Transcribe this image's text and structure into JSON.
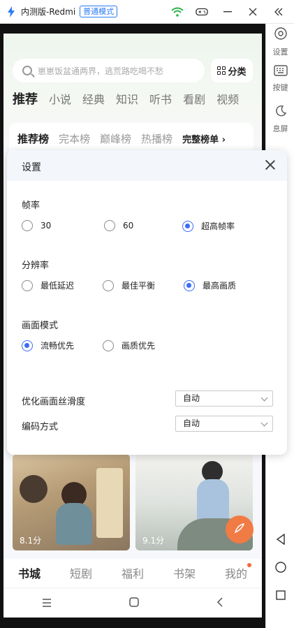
{
  "titlebar": {
    "title": "内测版-Redmi",
    "mode_badge": "普通模式"
  },
  "sidebar": {
    "items": [
      {
        "label": "设置",
        "icon": "settings-icon"
      },
      {
        "label": "按键",
        "icon": "keyboard-icon"
      },
      {
        "label": "息屏",
        "icon": "moon-icon"
      }
    ]
  },
  "app": {
    "search_placeholder": "崽崽饭盆通两界，逃荒路吃喝不愁",
    "category_button": "分类",
    "tabs": [
      "推荐",
      "小说",
      "经典",
      "知识",
      "听书",
      "看剧",
      "视频"
    ],
    "ranks": [
      "推荐榜",
      "完本榜",
      "巅峰榜",
      "热播榜"
    ],
    "rank_more": "完整榜单 ›",
    "covers": [
      {
        "rating": "8.1分"
      },
      {
        "rating": "9.1分"
      }
    ],
    "bottom_nav": [
      "书城",
      "短剧",
      "福利",
      "书架",
      "我的"
    ]
  },
  "settings": {
    "title": "设置",
    "frame_rate": {
      "label": "帧率",
      "options": [
        "30",
        "60",
        "超高帧率"
      ],
      "selected": "超高帧率"
    },
    "resolution": {
      "label": "分辨率",
      "options": [
        "最低延迟",
        "最佳平衡",
        "最高画质"
      ],
      "selected": "最高画质"
    },
    "picture_mode": {
      "label": "画面模式",
      "options": [
        "流畅优先",
        "画质优先"
      ],
      "selected": "流畅优先"
    },
    "smoothness": {
      "label": "优化画面丝滑度",
      "value": "自动"
    },
    "encoding": {
      "label": "编码方式",
      "value": "自动"
    }
  }
}
